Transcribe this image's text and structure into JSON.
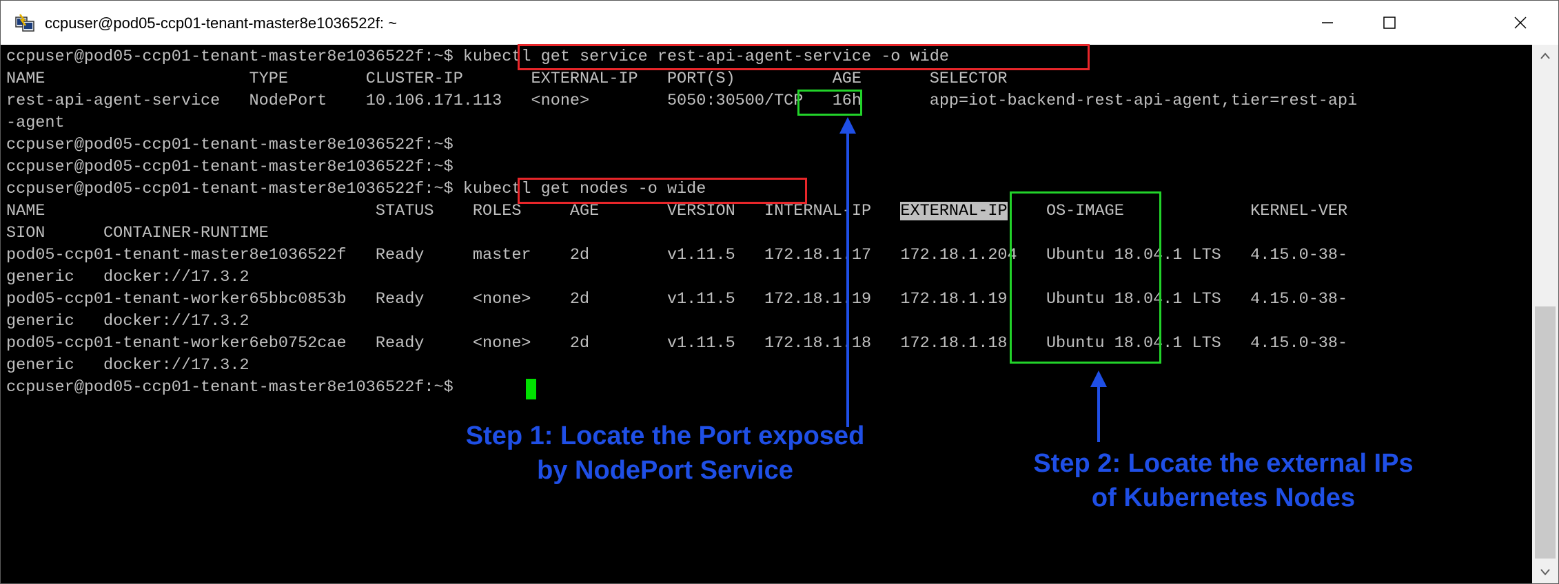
{
  "window": {
    "title": "ccpuser@pod05-ccp01-tenant-master8e1036522f: ~",
    "icons": {
      "app": "putty-icon",
      "minimize": "minimize-icon",
      "maximize": "maximize-icon",
      "close": "close-icon"
    }
  },
  "terminal": {
    "lines": [
      "ccpuser@pod05-ccp01-tenant-master8e1036522f:~$ kubectl get service rest-api-agent-service -o wide",
      "NAME                     TYPE        CLUSTER-IP       EXTERNAL-IP   PORT(S)          AGE       SELECTOR",
      "rest-api-agent-service   NodePort    10.106.171.113   <none>        5050:30500/TCP   16h       app=iot-backend-rest-api-agent,tier=rest-api",
      "-agent",
      "ccpuser@pod05-ccp01-tenant-master8e1036522f:~$",
      "ccpuser@pod05-ccp01-tenant-master8e1036522f:~$",
      "ccpuser@pod05-ccp01-tenant-master8e1036522f:~$ kubectl get nodes -o wide",
      "NAME                                  STATUS    ROLES     AGE       VERSION   INTERNAL-IP   EXTERNAL-IP    OS-IMAGE             KERNEL-VER",
      "SION      CONTAINER-RUNTIME",
      "pod05-ccp01-tenant-master8e1036522f   Ready     master    2d        v1.11.5   172.18.1.17   172.18.1.204   Ubuntu 18.04.1 LTS   4.15.0-38-",
      "generic   docker://17.3.2",
      "pod05-ccp01-tenant-worker65bbc0853b   Ready     <none>    2d        v1.11.5   172.18.1.19   172.18.1.19    Ubuntu 18.04.1 LTS   4.15.0-38-",
      "generic   docker://17.3.2",
      "pod05-ccp01-tenant-worker6eb0752cae   Ready     <none>    2d        v1.11.5   172.18.1.18   172.18.1.18    Ubuntu 18.04.1 LTS   4.15.0-38-",
      "generic   docker://17.3.2",
      "ccpuser@pod05-ccp01-tenant-master8e1036522f:~$ "
    ],
    "header_line_pre": "NAME                                  STATUS    ROLES     AGE       VERSION   INTERNAL-IP   ",
    "header_highlight": "EXTERNAL-IP",
    "header_line_post": "    OS-IMAGE             KERNEL-VER"
  },
  "annotations": {
    "step1": {
      "line1": "Step 1: Locate the Port exposed",
      "line2": "by NodePort Service"
    },
    "step2": {
      "line1": "Step 2: Locate the external IPs",
      "line2": "of Kubernetes Nodes"
    }
  },
  "colors": {
    "terminal_bg": "#000000",
    "terminal_fg": "#c0c0c0",
    "cursor": "#00e000",
    "command_box": "#e8262a",
    "value_box": "#22d32a",
    "step_text": "#1f4fe6"
  }
}
